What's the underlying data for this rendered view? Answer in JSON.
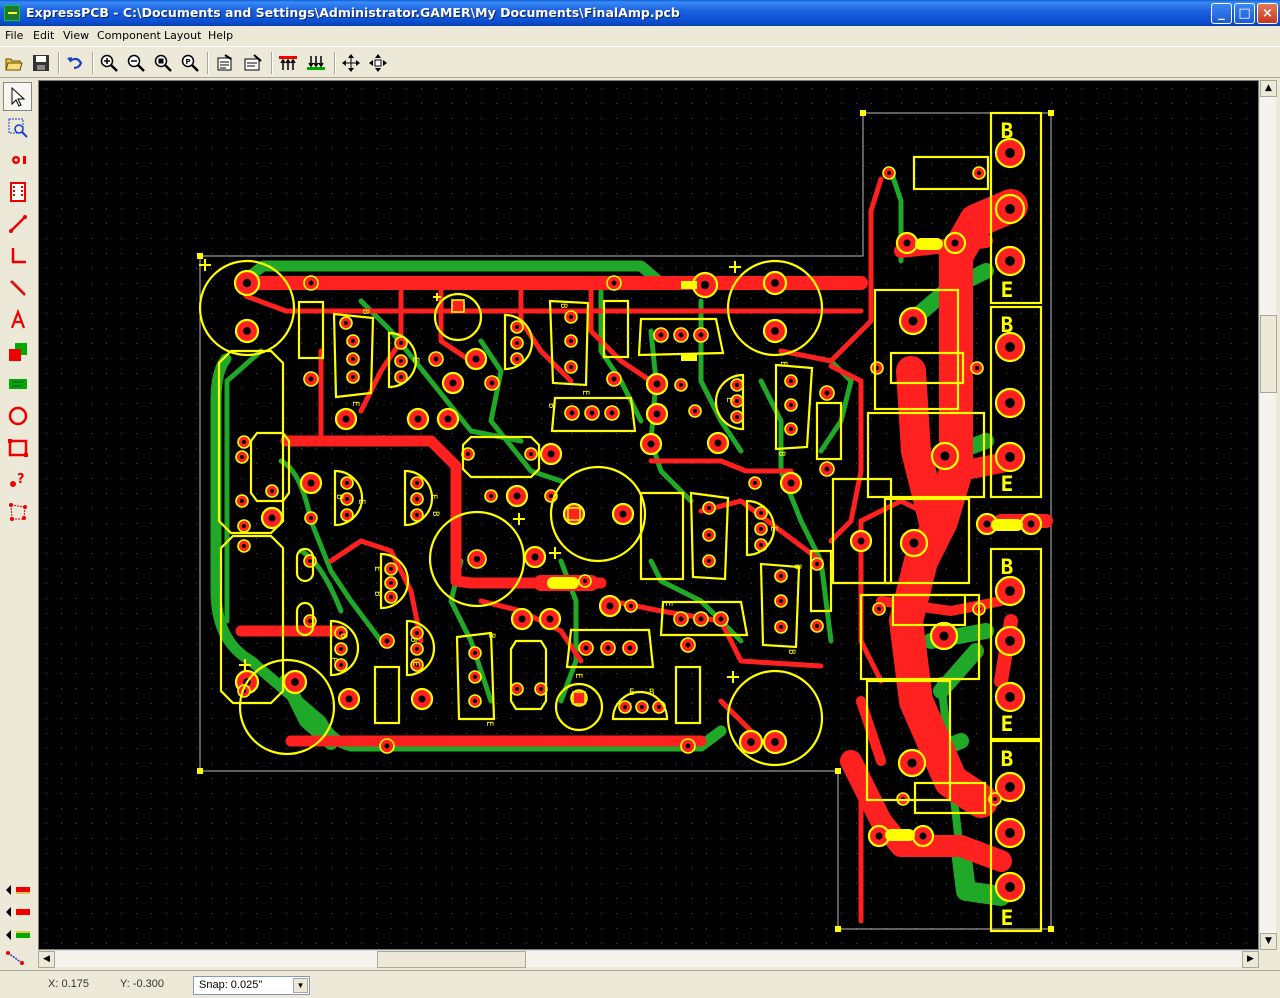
{
  "window": {
    "title": "ExpressPCB - C:\\Documents and Settings\\Administrator.GAMER\\My Documents\\FinalAmp.pcb",
    "minimize": "_",
    "maximize": "□",
    "close": "×"
  },
  "menu": [
    "File",
    "Edit",
    "View",
    "Component",
    "Layout",
    "Help"
  ],
  "toolbar": {
    "buttons": [
      "open-icon",
      "save-icon",
      "undo-icon",
      "zoom-in-icon",
      "zoom-out-icon",
      "zoom-window-icon",
      "zoom-fit-icon",
      "properties-icon",
      "component-properties-icon",
      "top-layer-icon",
      "bottom-layer-icon",
      "pan-icon",
      "move-icon"
    ]
  },
  "palette": {
    "tools": [
      "select-arrow-icon",
      "zoom-select-icon",
      "place-pad-icon",
      "place-component-icon",
      "trace-icon",
      "corner-trace-icon",
      "ratsnest-icon",
      "text-icon",
      "fill-plane-icon",
      "copper-area-icon",
      "circle-icon",
      "rectangle-icon",
      "query-pad-icon",
      "netlist-icon"
    ],
    "layers": [
      "top-layer-toggle",
      "bottom-layer-toggle",
      "silkscreen-toggle",
      "ratsnest-toggle"
    ]
  },
  "pcb": {
    "colors": {
      "background": "#000000",
      "grid": "#3a3a3a",
      "top_copper": "#ff2020",
      "bottom_copper": "#20b020",
      "silkscreen": "#ffff00",
      "outline": "#c8c8c8"
    },
    "labels": {
      "b": "B",
      "e": "E",
      "c": "C"
    }
  },
  "status": {
    "x": "X: 0.175",
    "y": "Y: -0.300",
    "snap_label": "Snap: 0.025\""
  }
}
